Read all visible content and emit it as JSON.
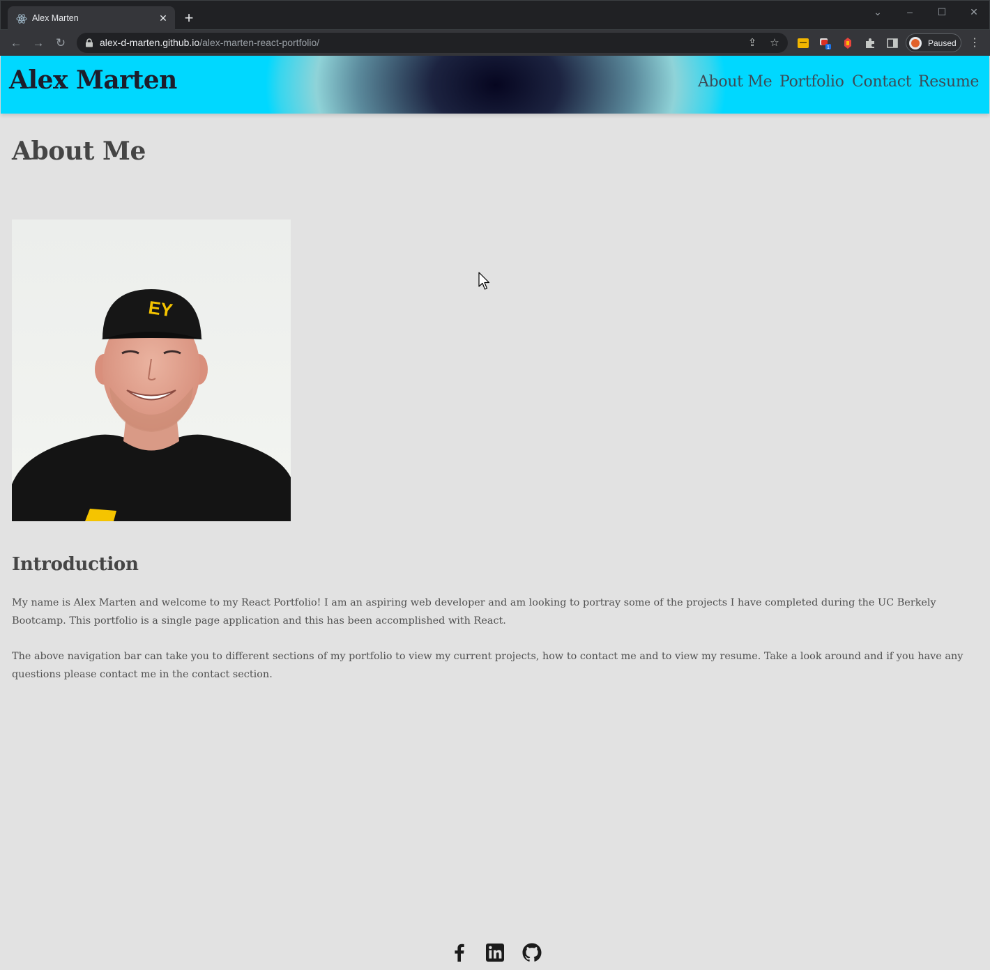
{
  "browser": {
    "tab_title": "Alex Marten",
    "url_host": "alex-d-marten.github.io",
    "url_path": "/alex-marten-react-portfolio/",
    "profile_label": "Paused",
    "extension_badge": "1"
  },
  "site": {
    "title": "Alex Marten",
    "nav": [
      "About Me",
      "Portfolio",
      "Contact",
      "Resume"
    ]
  },
  "about": {
    "heading": "About Me",
    "photo_alt": "Portrait of Alex Marten",
    "intro_heading": "Introduction",
    "paragraphs": [
      "My name is Alex Marten and welcome to my React Portfolio! I am an aspiring web developer and am looking to portray some of the projects I have completed during the UC Berkely Bootcamp. This portfolio is a single page application and this has been accomplished with React.",
      "The above navigation bar can take you to different sections of my portfolio to view my current projects, how to contact me and to view my resume. Take a look around and if you have any questions please contact me in the contact section."
    ]
  },
  "footer": {
    "social_icons": [
      "facebook-icon",
      "linkedin-icon",
      "github-icon"
    ]
  }
}
